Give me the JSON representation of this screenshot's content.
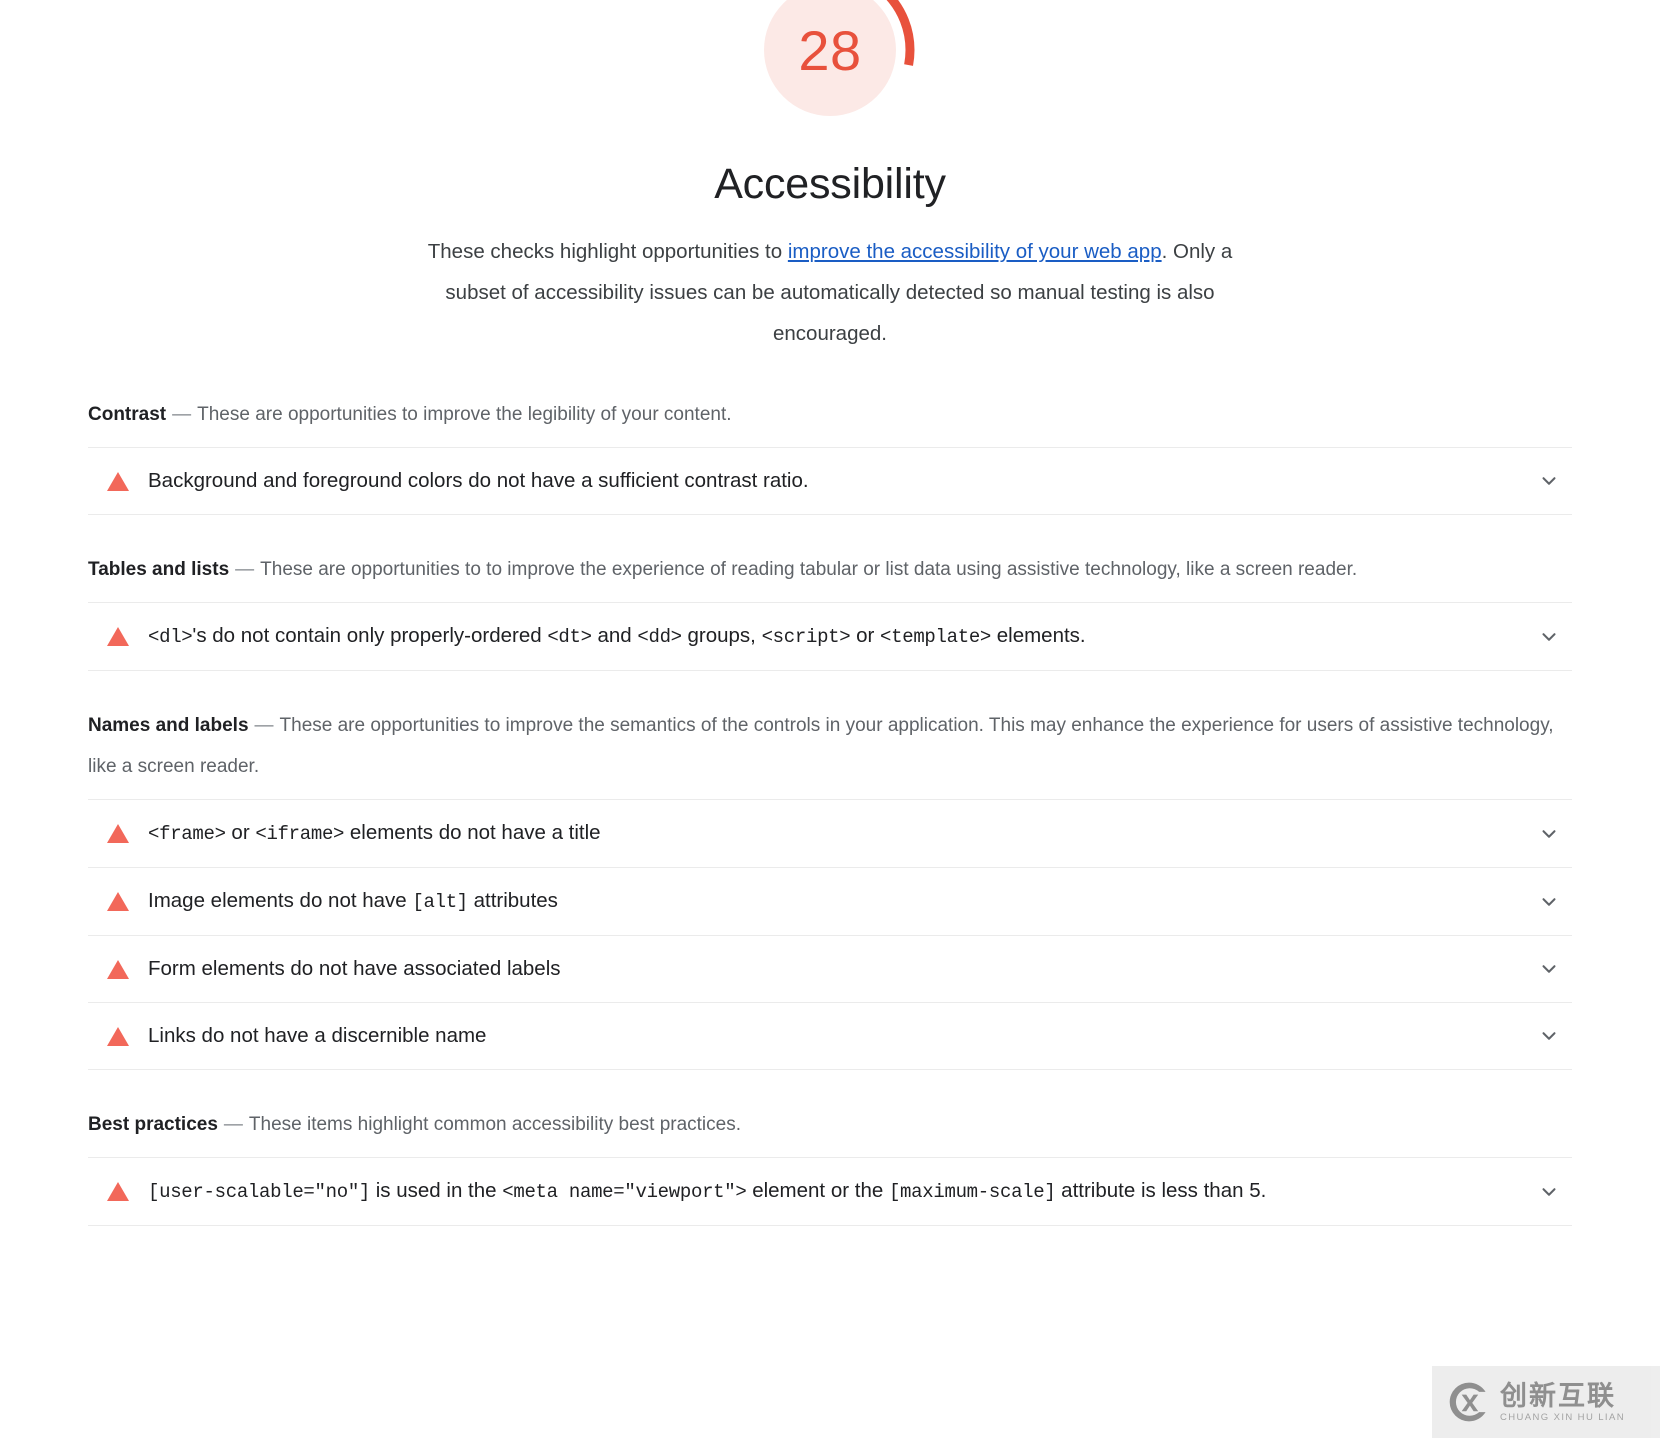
{
  "score": {
    "value": "28",
    "arc_color": "#e8513c",
    "fill_color": "#fce9e6",
    "max": 100
  },
  "header": {
    "title": "Accessibility",
    "description_part1": "These checks highlight opportunities to ",
    "description_link": "improve the accessibility of your web app",
    "description_part2": ". Only a subset of accessibility issues can be automatically detected so manual testing is also encouraged."
  },
  "groups": [
    {
      "title": "Contrast",
      "dash": "—",
      "description": "These are opportunities to improve the legibility of your content.",
      "audits": [
        {
          "icon": "warning-triangle-icon",
          "parts": [
            {
              "type": "text",
              "value": "Background and foreground colors do not have a sufficient contrast ratio."
            }
          ]
        }
      ]
    },
    {
      "title": "Tables and lists",
      "dash": "—",
      "description": "These are opportunities to to improve the experience of reading tabular or list data using assistive technology, like a screen reader.",
      "audits": [
        {
          "icon": "warning-triangle-icon",
          "parts": [
            {
              "type": "code",
              "value": "<dl>"
            },
            {
              "type": "text",
              "value": "'s do not contain only properly-ordered "
            },
            {
              "type": "code",
              "value": "<dt>"
            },
            {
              "type": "text",
              "value": " and "
            },
            {
              "type": "code",
              "value": "<dd>"
            },
            {
              "type": "text",
              "value": " groups, "
            },
            {
              "type": "code",
              "value": "<script>"
            },
            {
              "type": "text",
              "value": " or "
            },
            {
              "type": "code",
              "value": "<template>"
            },
            {
              "type": "text",
              "value": " elements."
            }
          ]
        }
      ]
    },
    {
      "title": "Names and labels",
      "dash": "—",
      "description": "These are opportunities to improve the semantics of the controls in your application. This may enhance the experience for users of assistive technology, like a screen reader.",
      "audits": [
        {
          "icon": "warning-triangle-icon",
          "parts": [
            {
              "type": "code",
              "value": "<frame>"
            },
            {
              "type": "text",
              "value": " or "
            },
            {
              "type": "code",
              "value": "<iframe>"
            },
            {
              "type": "text",
              "value": " elements do not have a title"
            }
          ]
        },
        {
          "icon": "warning-triangle-icon",
          "parts": [
            {
              "type": "text",
              "value": "Image elements do not have "
            },
            {
              "type": "code",
              "value": "[alt]"
            },
            {
              "type": "text",
              "value": " attributes"
            }
          ]
        },
        {
          "icon": "warning-triangle-icon",
          "parts": [
            {
              "type": "text",
              "value": "Form elements do not have associated labels"
            }
          ]
        },
        {
          "icon": "warning-triangle-icon",
          "parts": [
            {
              "type": "text",
              "value": "Links do not have a discernible name"
            }
          ]
        }
      ]
    },
    {
      "title": "Best practices",
      "dash": "—",
      "description": "These items highlight common accessibility best practices.",
      "audits": [
        {
          "icon": "warning-triangle-icon",
          "parts": [
            {
              "type": "code",
              "value": "[user-scalable=\"no\"]"
            },
            {
              "type": "text",
              "value": " is used in the "
            },
            {
              "type": "code",
              "value": "<meta name=\"viewport\">"
            },
            {
              "type": "text",
              "value": " element or the "
            },
            {
              "type": "code",
              "value": "[maximum-scale]"
            },
            {
              "type": "text",
              "value": " attribute is less than 5."
            }
          ]
        }
      ]
    }
  ],
  "expand_icon": "chevron-down-icon",
  "watermark": {
    "logo": "cx-circle-logo-icon",
    "chinese": "创新互联",
    "pinyin": "CHUANG XIN HU LIAN"
  }
}
